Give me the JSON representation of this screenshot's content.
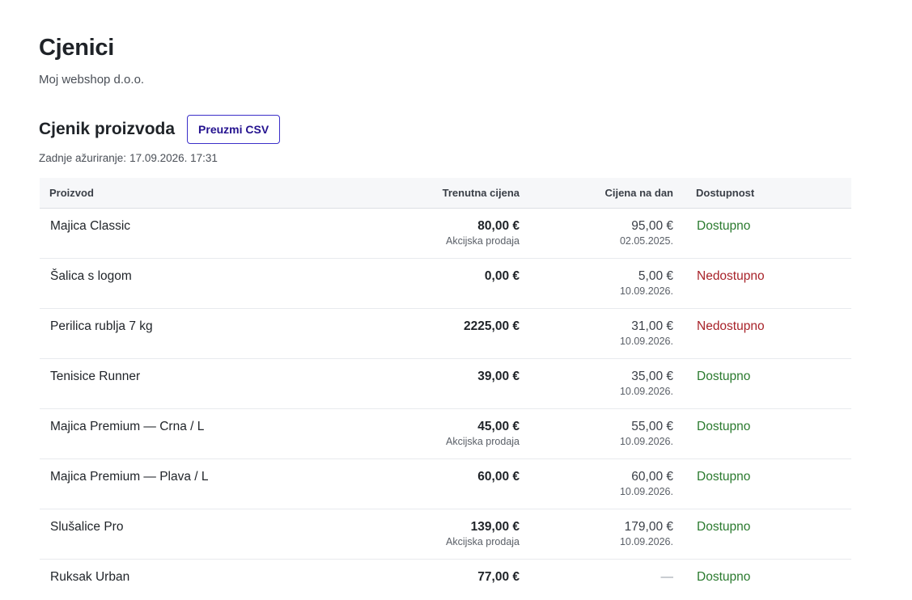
{
  "page": {
    "title": "Cjenici",
    "company": "Moj webshop d.o.o."
  },
  "section": {
    "title": "Cjenik proizvoda",
    "csv_button_label": "Preuzmi CSV",
    "updated_label": "Zadnje ažuriranje:",
    "updated_value": "17.09.2026. 17:31"
  },
  "table": {
    "columns": {
      "product": "Proizvod",
      "current_price": "Trenutna cijena",
      "price_on_day": "Cijena na dan",
      "availability": "Dostupnost"
    },
    "rows": [
      {
        "name": "Majica Classic",
        "current_price": "80,00 €",
        "note": "Akcijska prodaja",
        "day_price": "95,00 €",
        "day_date": "02.05.2025.",
        "availability": "Dostupno",
        "available": true
      },
      {
        "name": "Šalica s logom",
        "current_price": "0,00 €",
        "note": "",
        "day_price": "5,00 €",
        "day_date": "10.09.2026.",
        "availability": "Nedostupno",
        "available": false
      },
      {
        "name": "Perilica rublja 7 kg",
        "current_price": "2225,00 €",
        "note": "",
        "day_price": "31,00 €",
        "day_date": "10.09.2026.",
        "availability": "Nedostupno",
        "available": false
      },
      {
        "name": "Tenisice Runner",
        "current_price": "39,00 €",
        "note": "",
        "day_price": "35,00 €",
        "day_date": "10.09.2026.",
        "availability": "Dostupno",
        "available": true
      },
      {
        "name": "Majica Premium — Crna / L",
        "current_price": "45,00 €",
        "note": "Akcijska prodaja",
        "day_price": "55,00 €",
        "day_date": "10.09.2026.",
        "availability": "Dostupno",
        "available": true
      },
      {
        "name": "Majica Premium — Plava / L",
        "current_price": "60,00 €",
        "note": "",
        "day_price": "60,00 €",
        "day_date": "10.09.2026.",
        "availability": "Dostupno",
        "available": true
      },
      {
        "name": "Slušalice Pro",
        "current_price": "139,00 €",
        "note": "Akcijska prodaja",
        "day_price": "179,00 €",
        "day_date": "10.09.2026.",
        "availability": "Dostupno",
        "available": true
      },
      {
        "name": "Ruksak Urban",
        "current_price": "77,00 €",
        "note": "",
        "day_price": "—",
        "day_date": "",
        "availability": "Dostupno",
        "available": true
      }
    ]
  },
  "colors": {
    "available": "#2a7a2e",
    "unavailable": "#a8232a",
    "accent": "#3b2fc9"
  }
}
